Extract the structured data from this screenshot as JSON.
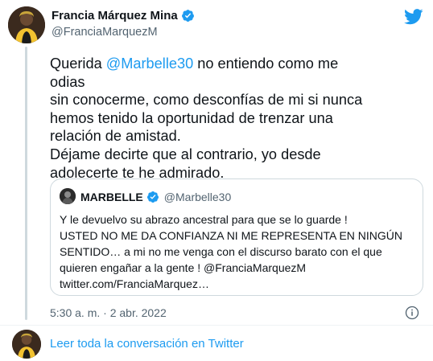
{
  "author": {
    "name": "Francia Márquez Mina",
    "handle": "@FranciaMarquezM"
  },
  "tweet": {
    "line1_prefix": "Querida ",
    "mention": "@Marbelle30",
    "line1_suffix": " no entiendo como me odias\nsin conocerme, como desconfías de mi si nunca\nhemos tenido la oportunidad de trenzar una\nrelación de amistad.\nDéjame decirte que al contrario, yo desde\nadolecerte te he admirado."
  },
  "quote": {
    "name": "MARBELLE",
    "handle": "@Marbelle30",
    "text": "Y le devuelvo su abrazo ancestral para que se lo guarde !\nUSTED NO ME DA CONFIANZA NI ME REPRESENTA EN NINGÚN\nSENTIDO… a mi no me venga con el discurso barato con el que\nquieren engañar a la gente ! @FranciaMarquezM\ntwitter.com/FranciaMarquez…"
  },
  "timestamp": "5:30 a. m. · 2 abr. 2022",
  "read_more": "Leer toda la conversación en Twitter",
  "colors": {
    "accent": "#1d9bf0",
    "text": "#0f1419",
    "muted": "#536471",
    "border": "#cfd9de"
  },
  "icons": {
    "verified": "verified-badge-icon",
    "logo": "twitter-bird-icon",
    "info": "info-icon"
  }
}
